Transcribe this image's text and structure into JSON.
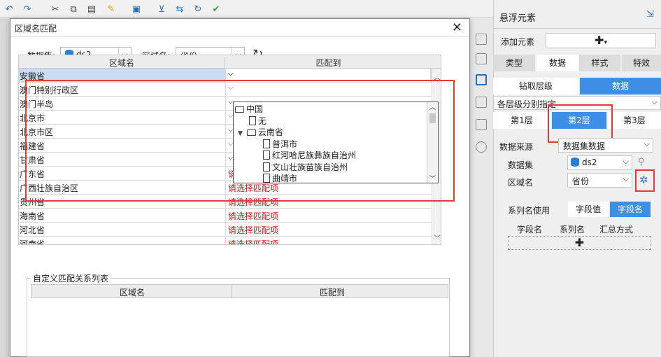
{
  "toolbar": {
    "file_path": "目志中产量.../.../...   Quanshutenchanen_...reserve...der...seroberiens..."
  },
  "dialog": {
    "title": "区域名匹配",
    "dataset_label": "数据集:",
    "dataset_value": "ds2",
    "region_label": "区域名:",
    "region_value": "省份",
    "col_region": "区域名",
    "col_match": "匹配到",
    "placeholder": "请选择匹配项",
    "rows": [
      "安徽省",
      "澳门特别行政区",
      "澳门半岛",
      "北京市",
      "北京市区",
      "福建省",
      "甘肃省",
      "广东省",
      "广西壮族自治区",
      "贵州省",
      "海南省",
      "河北省",
      "河南省"
    ],
    "tree": {
      "root": "中国",
      "none": "无",
      "province": "云南省",
      "items": [
        "普洱市",
        "红河哈尼族彝族自治州",
        "文山壮族苗族自治州",
        "曲靖市"
      ]
    },
    "custom_title": "自定义匹配关系列表",
    "custom_col_region": "区域名",
    "custom_col_match": "匹配到"
  },
  "panel": {
    "title": "悬浮元素",
    "add_label": "添加元素",
    "tabs": [
      "类型",
      "数据",
      "样式",
      "特效"
    ],
    "drill_label": "钻取层级",
    "data_label": "数据",
    "level_select": "各层级分别指定",
    "layers": [
      "第1层",
      "第2层",
      "第3层"
    ],
    "source_label": "数据来源",
    "source_value": "数据集数据",
    "dataset_label": "数据集",
    "dataset_value": "ds2",
    "region_label": "区域名",
    "region_value": "省份",
    "series_label": "系列名使用",
    "series_opt1": "字段值",
    "series_opt2": "字段名",
    "cols": [
      "字段名",
      "系列名",
      "汇总方式"
    ]
  },
  "colors": {
    "accent": "#3d8fe6",
    "highlight": "#e23b3b",
    "placeholder": "#d21a1a",
    "selected_row": "#c9dcf2"
  }
}
